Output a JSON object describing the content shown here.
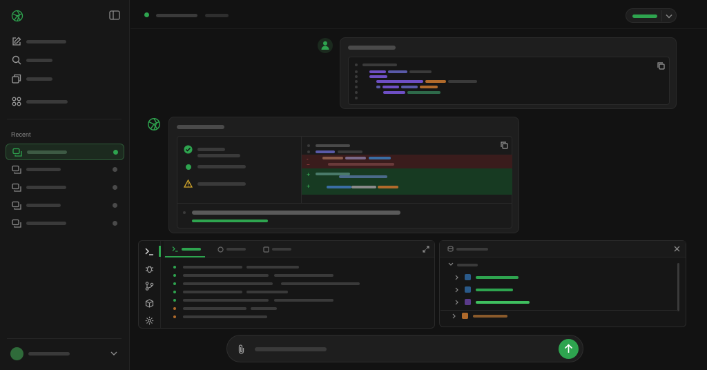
{
  "sidebar": {
    "recent_label": "Recent"
  },
  "icons": {
    "logo": "openai-logo-icon",
    "sidebar_toggle": "sidebar-toggle-icon",
    "new_chat": "edit-icon",
    "search": "search-icon",
    "library": "images-icon",
    "apps": "grid-icon",
    "chat": "chat-bubble-icon",
    "user": "user-icon",
    "check": "check-circle-icon",
    "warning": "warning-icon",
    "copy": "copy-icon",
    "attach": "paperclip-icon",
    "send": "arrow-up-icon"
  },
  "colors": {
    "accent": "#2ea44f",
    "background": "#121212",
    "sidebar": "#171717",
    "panel": "#1e1e1e"
  }
}
